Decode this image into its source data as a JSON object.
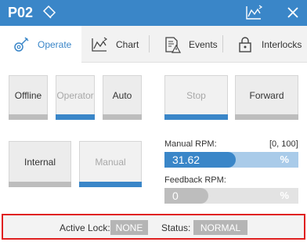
{
  "window": {
    "title": "P02"
  },
  "tabs": [
    {
      "label": "Operate",
      "icon": "settings-wrench-icon",
      "active": true
    },
    {
      "label": "Chart",
      "icon": "chart-icon",
      "active": false
    },
    {
      "label": "Events",
      "icon": "events-warning-icon",
      "active": false
    },
    {
      "label": "Interlocks",
      "icon": "lock-icon",
      "active": false
    }
  ],
  "mode_buttons": {
    "offline": {
      "label": "Offline",
      "selected": false,
      "enabled": true
    },
    "operator": {
      "label": "Operator",
      "selected": true,
      "enabled": false
    },
    "auto": {
      "label": "Auto",
      "selected": false,
      "enabled": true
    },
    "stop": {
      "label": "Stop",
      "selected": true,
      "enabled": false
    },
    "forward": {
      "label": "Forward",
      "selected": false,
      "enabled": true
    },
    "internal": {
      "label": "Internal",
      "selected": false,
      "enabled": true
    },
    "manual": {
      "label": "Manual",
      "selected": true,
      "enabled": false
    }
  },
  "manual_rpm": {
    "label": "Manual RPM:",
    "range": "[0, 100]",
    "value": "31.62",
    "unit": "%",
    "fraction": 0.3162
  },
  "feedback_rpm": {
    "label": "Feedback RPM:",
    "value": "0",
    "unit": "%",
    "fraction": 0.0
  },
  "status_bar": {
    "active_lock_label": "Active Lock:",
    "active_lock_value": "NONE",
    "status_label": "Status:",
    "status_value": "NORMAL"
  },
  "colors": {
    "accent": "#3a86c8",
    "highlight_border": "#e02020",
    "chip": "#b5b5b5"
  }
}
